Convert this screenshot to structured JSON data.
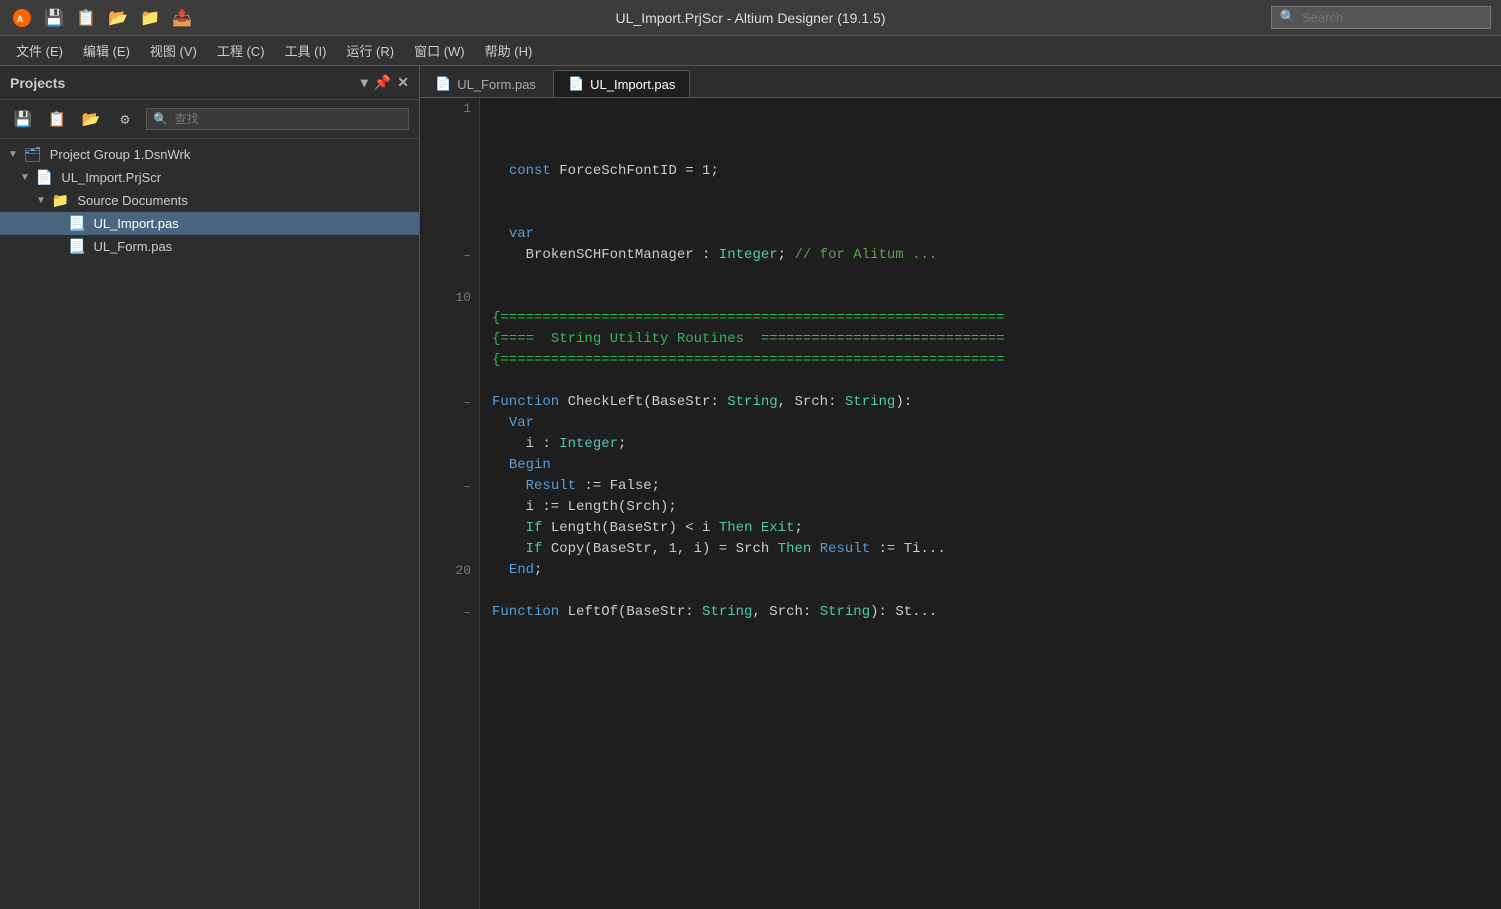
{
  "titlebar": {
    "title": "UL_Import.PrjScr - Altium Designer (19.1.5)",
    "search_placeholder": "Search"
  },
  "menubar": {
    "items": [
      "文件 (E)",
      "编辑 (E)",
      "视图 (V)",
      "工程 (C)",
      "工具 (I)",
      "运行 (R)",
      "窗口 (W)",
      "帮助 (H)"
    ]
  },
  "sidebar": {
    "title": "Projects",
    "search_placeholder": "🔍  查找",
    "tree": [
      {
        "label": "Project Group 1.DsnWrk",
        "level": 0,
        "type": "group",
        "expanded": true
      },
      {
        "label": "UL_Import.PrjScr",
        "level": 1,
        "type": "project",
        "expanded": true
      },
      {
        "label": "Source Documents",
        "level": 2,
        "type": "folder",
        "expanded": true
      },
      {
        "label": "UL_Import.pas",
        "level": 3,
        "type": "file",
        "selected": true
      },
      {
        "label": "UL_Form.pas",
        "level": 3,
        "type": "file",
        "selected": false
      }
    ]
  },
  "tabs": [
    {
      "label": "UL_Form.pas",
      "active": false
    },
    {
      "label": "UL_Import.pas",
      "active": true
    }
  ],
  "code": {
    "lines": [
      {
        "num": "1",
        "minus": false,
        "content": ""
      },
      {
        "num": "",
        "minus": false,
        "content": ""
      },
      {
        "num": "",
        "minus": false,
        "content": ""
      },
      {
        "num": "",
        "minus": false,
        "content": "  const ForceSchFontID = 1;"
      },
      {
        "num": "",
        "minus": false,
        "content": ""
      },
      {
        "num": "",
        "minus": false,
        "content": ""
      },
      {
        "num": "",
        "minus": false,
        "content": "  var"
      },
      {
        "num": "–",
        "minus": true,
        "content": "    BrokenSCHFontManager : Integer; // for Alitum ..."
      },
      {
        "num": "",
        "minus": false,
        "content": ""
      },
      {
        "num": "10",
        "minus": false,
        "content": ""
      },
      {
        "num": "",
        "minus": false,
        "content": "{============================================================"
      },
      {
        "num": "",
        "minus": false,
        "content": "{====  String Utility Routines  ============================="
      },
      {
        "num": "",
        "minus": false,
        "content": "{============================================================"
      },
      {
        "num": "",
        "minus": false,
        "content": ""
      },
      {
        "num": "–",
        "minus": true,
        "content": "Function CheckLeft(BaseStr: String, Srch: String):"
      },
      {
        "num": "",
        "minus": false,
        "content": "  Var"
      },
      {
        "num": "",
        "minus": false,
        "content": "    i : Integer;"
      },
      {
        "num": "",
        "minus": false,
        "content": "  Begin"
      },
      {
        "num": "–",
        "minus": true,
        "content": "    Result := False;"
      },
      {
        "num": "",
        "minus": false,
        "content": "    i := Length(Srch);"
      },
      {
        "num": "",
        "minus": false,
        "content": "    If Length(BaseStr) < i Then Exit;"
      },
      {
        "num": "",
        "minus": false,
        "content": "    If Copy(BaseStr, 1, i) = Srch Then Result := Ti..."
      },
      {
        "num": "20",
        "minus": false,
        "content": "  End;"
      },
      {
        "num": "",
        "minus": false,
        "content": ""
      },
      {
        "num": "–",
        "minus": true,
        "content": "Function LeftOf(BaseStr: String, Srch: String): St..."
      }
    ]
  }
}
